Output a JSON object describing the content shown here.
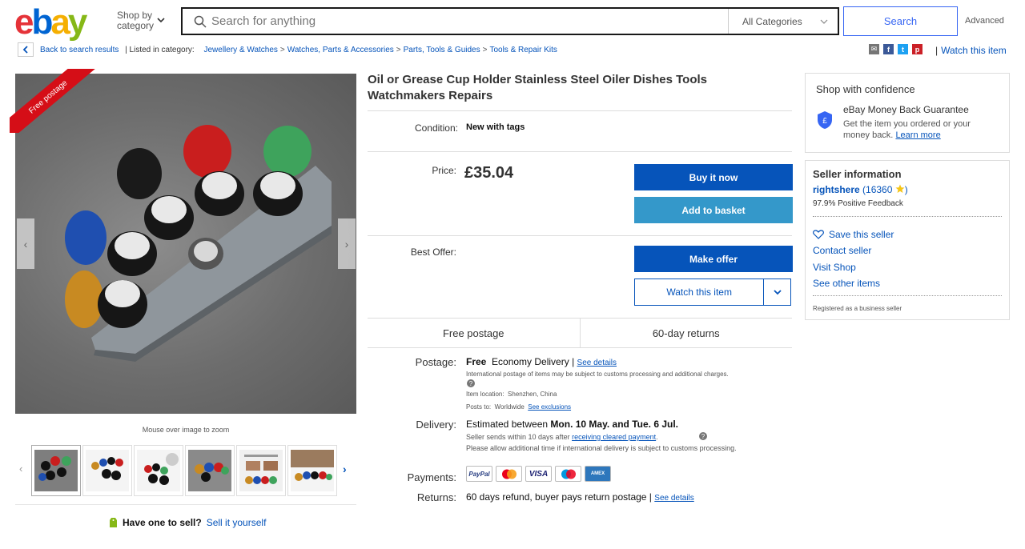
{
  "header": {
    "logo": {
      "e": "e",
      "b": "b",
      "a": "a",
      "y": "y"
    },
    "shop_by_line1": "Shop by",
    "shop_by_line2": "category",
    "search_placeholder": "Search for anything",
    "category_select": "All Categories",
    "search_button": "Search",
    "advanced": "Advanced"
  },
  "breadcrumb": {
    "back": "Back to search results",
    "listed_in": "| Listed in category:",
    "items": [
      "Jewellery & Watches",
      "Watches, Parts & Accessories",
      "Parts, Tools & Guides",
      "Tools & Repair Kits"
    ],
    "watch_item": "Watch this item"
  },
  "gallery": {
    "ribbon": "Free postage",
    "zoom_caption": "Mouse over image to zoom",
    "thumbnail_count": 6
  },
  "sell": {
    "prompt": "Have one to sell?",
    "link": "Sell it yourself"
  },
  "item": {
    "title": "Oil or Grease Cup Holder Stainless Steel Oiler Dishes Tools Watchmakers Repairs",
    "condition_label": "Condition:",
    "condition_value": "New with tags",
    "price_label": "Price:",
    "price": "£35.04",
    "buy_now": "Buy it now",
    "add_basket": "Add to basket",
    "best_offer_label": "Best Offer:",
    "make_offer": "Make offer",
    "watch": "Watch this item",
    "feature_1": "Free postage",
    "feature_2": "60-day returns"
  },
  "postage": {
    "label": "Postage:",
    "free": "Free",
    "method": "Economy Delivery |",
    "see_details": "See details",
    "intl_note": "International postage of items may be subject to customs processing and additional charges.",
    "location_label": "Item location:",
    "location": "Shenzhen, China",
    "posts_to_label": "Posts to:",
    "posts_to": "Worldwide",
    "see_exclusions": "See exclusions"
  },
  "delivery": {
    "label": "Delivery:",
    "estimate_prefix": "Estimated between",
    "estimate_dates": "Mon. 10 May. and Tue. 6 Jul.",
    "sends_prefix": "Seller sends within 10 days after",
    "sends_link": "receiving cleared payment",
    "sends_suffix": ".",
    "note": "Please allow additional time if international delivery is subject to customs processing."
  },
  "payments": {
    "label": "Payments:",
    "methods": [
      "PayPal",
      "Mastercard",
      "VISA",
      "Maestro",
      "AMEX"
    ]
  },
  "returns": {
    "label": "Returns:",
    "text": "60 days refund, buyer pays return postage |",
    "see_details": "See details"
  },
  "confidence": {
    "heading": "Shop with confidence",
    "guarantee_title": "eBay Money Back Guarantee",
    "guarantee_text": "Get the item you ordered or your money back.",
    "learn_more": "Learn more"
  },
  "seller": {
    "heading": "Seller information",
    "name": "rightshere",
    "feedback_open": "(",
    "feedback_score": "16360",
    "feedback_close": ")",
    "positive": "97.9% Positive Feedback",
    "save": "Save this seller",
    "contact": "Contact seller",
    "visit": "Visit Shop",
    "other_items": "See other items",
    "registered": "Registered as a business seller"
  }
}
